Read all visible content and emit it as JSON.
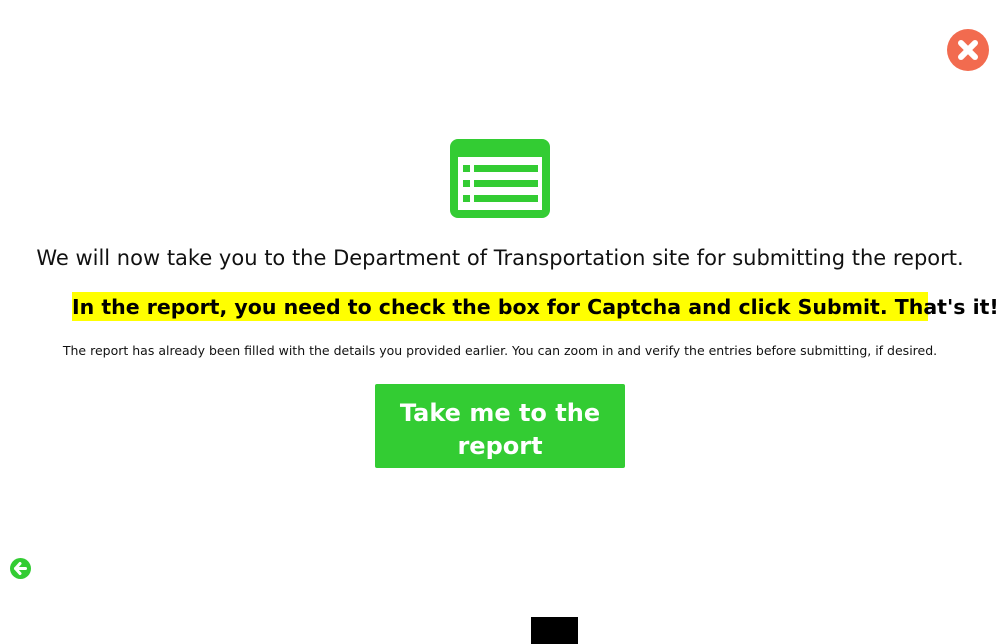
{
  "colors": {
    "accent_green": "#33cc33",
    "close_red": "#f26b4f",
    "highlight_yellow": "#ffff00"
  },
  "icons": {
    "close": "close-icon",
    "list": "list-icon",
    "back": "arrow-left-circle-icon"
  },
  "dialog": {
    "headline": "We will now take you to the Department of Transportation site for submitting the report.",
    "highlight": "In the report, you need to check the box for Captcha and click Submit. That's it!",
    "note": "The report has already been filled with the details you provided earlier. You can zoom in and verify the entries before submitting, if desired.",
    "cta_label": "Take me to the report"
  }
}
